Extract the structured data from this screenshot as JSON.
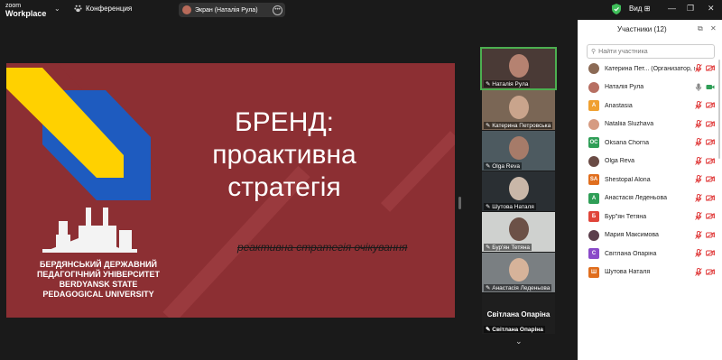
{
  "app": {
    "brand_line1": "zoom",
    "brand_line2": "Workplace"
  },
  "header": {
    "conference_label": "Конференция",
    "share_label": "Экран (Наталія Рула)",
    "view_label": "Вид"
  },
  "slide": {
    "title_lines": [
      "БРЕНД:",
      "проактивна",
      "стратегія"
    ],
    "struck_text": "реактивна стратегія очікування",
    "university_lines": [
      "БЕРДЯНСЬКИЙ ДЕРЖАВНИЙ",
      "ПЕДАГОГІЧНИЙ УНІВЕРСИТЕТ",
      "BERDYANSK STATE",
      "PEDAGOGICAL UNIVERSITY"
    ]
  },
  "gallery": [
    {
      "name": "Наталія Рула",
      "type": "video",
      "bg": "#4a3a36",
      "head": "#b58271"
    },
    {
      "name": "Катерина Петровська",
      "type": "video",
      "bg": "#7a6655",
      "head": "#c9a48c"
    },
    {
      "name": "Olga Reva",
      "type": "video",
      "bg": "#4d5a60",
      "head": "#a67b69"
    },
    {
      "name": "Шутова Наталя",
      "type": "video",
      "bg": "#2a2f33",
      "head": "#c9b7a8"
    },
    {
      "name": "Бур'ян Тетяна",
      "type": "video",
      "bg": "#cfd1cf",
      "head": "#6c5147"
    },
    {
      "name": "Анастасія Леденьова",
      "type": "video",
      "bg": "#7a7f82",
      "head": "#d6b39a"
    },
    {
      "name": "Світлана Опаріна",
      "type": "text",
      "bg": "#1e1e1e",
      "head": ""
    }
  ],
  "panel": {
    "title": "Участники (12)",
    "search_placeholder": "Найти участника",
    "participants": [
      {
        "name": "Катерина Пет... (Организатор, я)",
        "initials": "",
        "color": "#8b6a55",
        "photo": true,
        "mic": "off",
        "cam": "off"
      },
      {
        "name": "Наталія Рула",
        "initials": "",
        "color": "#b76f62",
        "photo": true,
        "mic": "on",
        "cam": "on"
      },
      {
        "name": "Anastasia",
        "initials": "A",
        "color": "#f0a030",
        "photo": false,
        "mic": "off",
        "cam": "off"
      },
      {
        "name": "Nataliia Sluzhava",
        "initials": "",
        "color": "#d69b82",
        "photo": true,
        "mic": "off",
        "cam": "off"
      },
      {
        "name": "Oksana Chorna",
        "initials": "OC",
        "color": "#2f9e57",
        "photo": false,
        "mic": "off",
        "cam": "off"
      },
      {
        "name": "Olga Reva",
        "initials": "",
        "color": "#6a4b45",
        "photo": true,
        "mic": "off",
        "cam": "off"
      },
      {
        "name": "Shestopal Alona",
        "initials": "SA",
        "color": "#e06e1e",
        "photo": false,
        "mic": "off",
        "cam": "off"
      },
      {
        "name": "Анастасія Леденьова",
        "initials": "А",
        "color": "#2f9e57",
        "photo": false,
        "mic": "off",
        "cam": "off"
      },
      {
        "name": "Бур\"ян Тетяна",
        "initials": "Б",
        "color": "#e0453a",
        "photo": false,
        "mic": "off",
        "cam": "off"
      },
      {
        "name": "Мария Максимова",
        "initials": "",
        "color": "#5b3e4b",
        "photo": true,
        "mic": "off",
        "cam": "off"
      },
      {
        "name": "Світлана Опаріна",
        "initials": "С",
        "color": "#8a4ac9",
        "photo": false,
        "mic": "off",
        "cam": "off"
      },
      {
        "name": "Шутова Наталя",
        "initials": "Ш",
        "color": "#e06e1e",
        "photo": false,
        "mic": "off",
        "cam": "off"
      }
    ]
  },
  "colors": {
    "slide_bg": "#8c2f33",
    "flag_blue": "#1e5bbf",
    "flag_yellow": "#ffd100",
    "active_outline": "#4caf50",
    "muted_red": "#e03b3b"
  }
}
